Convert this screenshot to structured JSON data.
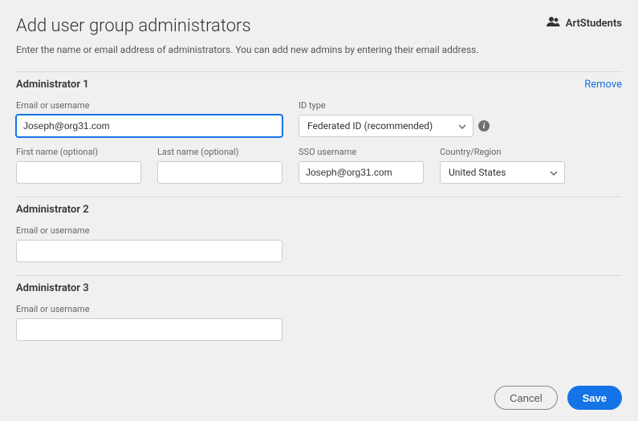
{
  "header": {
    "title": "Add user group administrators",
    "group_name": "ArtStudents",
    "subtitle": "Enter the name or email address of administrators. You can add new admins by entering their email address."
  },
  "labels": {
    "email_or_username": "Email or username",
    "id_type": "ID type",
    "first_name": "First name (optional)",
    "last_name": "Last name (optional)",
    "sso_username": "SSO username",
    "country_region": "Country/Region",
    "remove": "Remove"
  },
  "admin1": {
    "heading": "Administrator 1",
    "email_value": "Joseph@org31.com",
    "id_type_value": "Federated ID (recommended)",
    "first_name_value": "",
    "last_name_value": "",
    "sso_username_value": "Joseph@org31.com",
    "country_value": "United States"
  },
  "admin2": {
    "heading": "Administrator 2",
    "email_value": ""
  },
  "admin3": {
    "heading": "Administrator 3",
    "email_value": ""
  },
  "footer": {
    "cancel": "Cancel",
    "save": "Save"
  }
}
